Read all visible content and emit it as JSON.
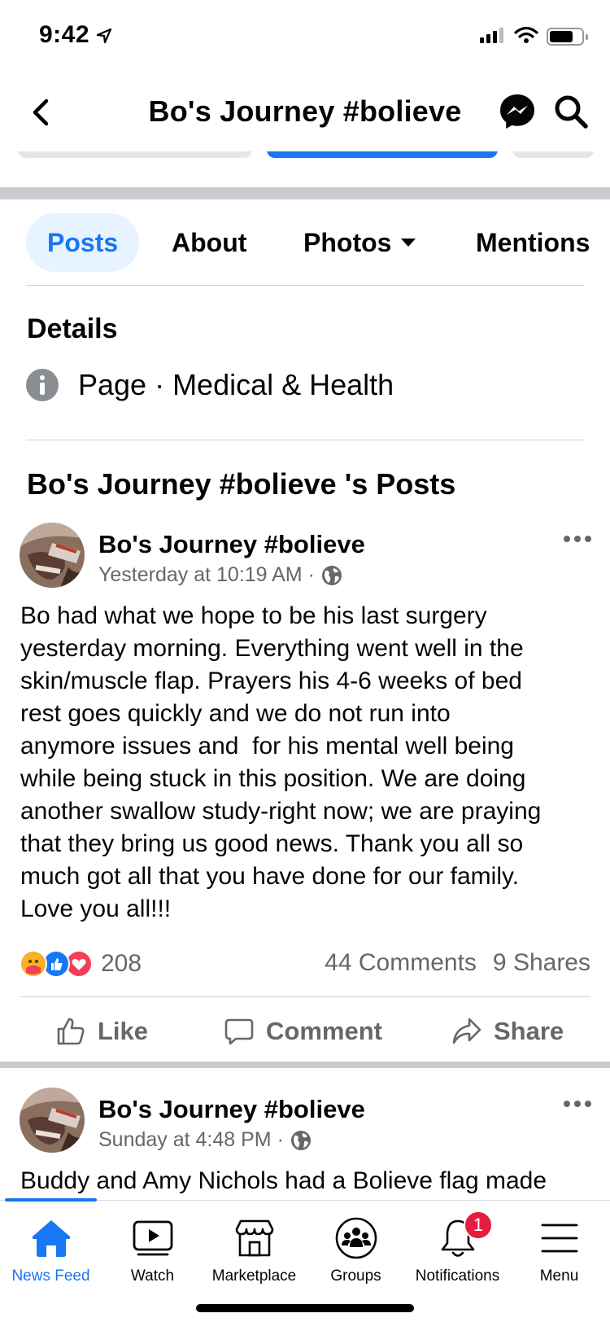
{
  "status_bar": {
    "time": "9:42"
  },
  "header": {
    "title": "Bo's Journey #bolieve"
  },
  "tabs": [
    {
      "label": "Posts",
      "active": true
    },
    {
      "label": "About"
    },
    {
      "label": "Photos"
    },
    {
      "label": "Mentions"
    }
  ],
  "details": {
    "title": "Details",
    "category": "Page · Medical & Health"
  },
  "posts_heading": "Bo's Journey #bolieve 's Posts",
  "posts": [
    {
      "author": "Bo's Journey #bolieve",
      "time": "Yesterday at 10:19 AM ·",
      "body": "Bo had what we hope to be his last surgery\nyesterday morning. Everything went well in the\nskin/muscle flap. Prayers his 4-6 weeks of bed\nrest goes quickly and we do not run into\nanymore issues and  for his mental well being\nwhile being stuck in this position. We are doing\nanother swallow study-right now; we are praying\nthat they bring us good news. Thank you all so\nmuch got all that you have done for our family.\nLove you all!!!",
      "reactions_count": "208",
      "comments": "44 Comments",
      "shares": "9 Shares",
      "actions": {
        "like": "Like",
        "comment": "Comment",
        "share": "Share"
      }
    },
    {
      "author": "Bo's Journey #bolieve",
      "time": "Sunday at 4:48 PM ·",
      "body": "Buddy and Amy Nichols had a Bolieve flag made"
    }
  ],
  "tabbar": {
    "items": [
      {
        "label": "News Feed",
        "icon": "home-icon",
        "active": true
      },
      {
        "label": "Watch",
        "icon": "watch-icon"
      },
      {
        "label": "Marketplace",
        "icon": "marketplace-icon"
      },
      {
        "label": "Groups",
        "icon": "groups-icon"
      },
      {
        "label": "Notifications",
        "icon": "bell-icon",
        "badge": "1"
      },
      {
        "label": "Menu",
        "icon": "menu-icon"
      }
    ]
  },
  "colors": {
    "accent": "#1877f2",
    "secondary_text": "#65676b",
    "badge": "#e41e3f"
  }
}
